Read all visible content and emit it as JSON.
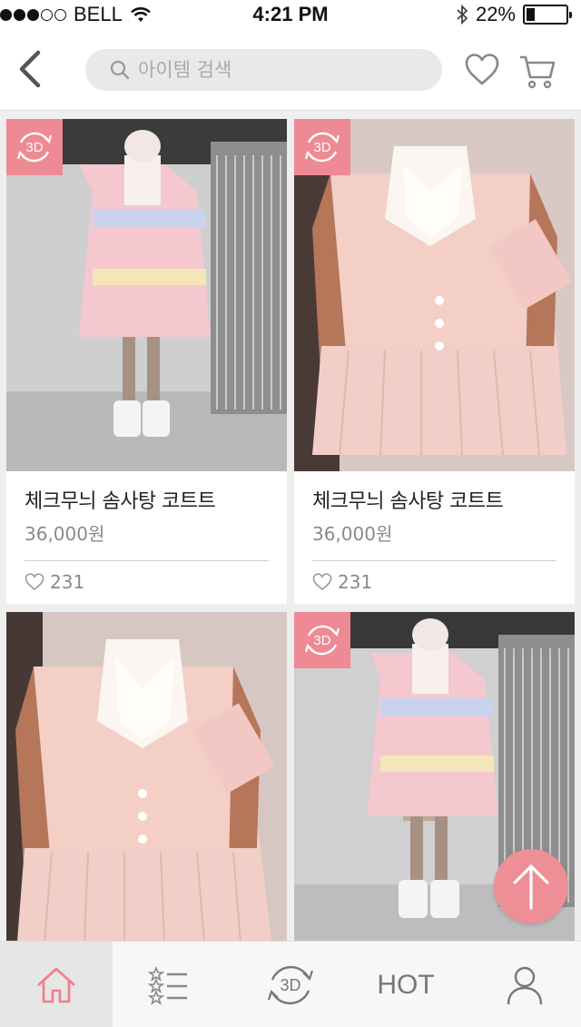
{
  "status_bar": {
    "carrier": "BELL",
    "time": "4:21 PM",
    "battery": "22%",
    "battery_level": 0.22
  },
  "header": {
    "search_placeholder": "아이템 검색"
  },
  "badges": {
    "three_d": "3D"
  },
  "products": [
    {
      "name": "체크무늬 솜사탕 코트트",
      "price": "36,000원",
      "likes": "231",
      "has_3d": true
    },
    {
      "name": "체크무늬 솜사탕 코트트",
      "price": "36,000원",
      "likes": "231",
      "has_3d": true
    },
    {
      "name": "",
      "price": "",
      "likes": "",
      "has_3d": false
    },
    {
      "name": "",
      "price": "",
      "likes": "",
      "has_3d": true
    }
  ],
  "tabbar": {
    "items": [
      {
        "icon": "home-icon",
        "active": true
      },
      {
        "icon": "ranking-list-icon",
        "active": false
      },
      {
        "icon": "3d-view-icon",
        "label": "3D",
        "active": false
      },
      {
        "label": "HOT",
        "active": false
      },
      {
        "icon": "user-icon",
        "active": false
      }
    ]
  },
  "colors": {
    "accent": "#ee8a93",
    "active_tab_bg": "#e6e6e6"
  }
}
